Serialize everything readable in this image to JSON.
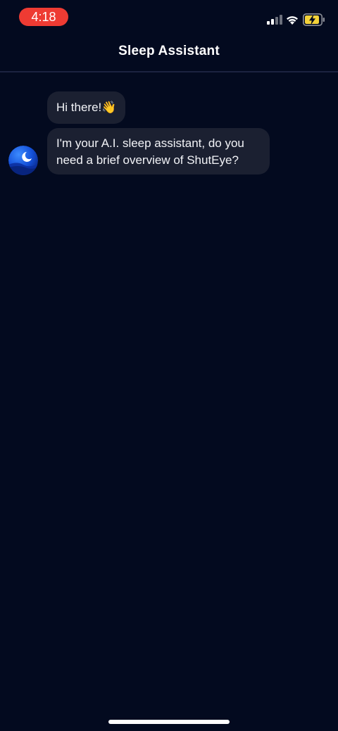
{
  "status_bar": {
    "time": "4:18",
    "icons": [
      "signal-icon",
      "wifi-icon",
      "battery-charging-icon"
    ],
    "time_pill_color": "#ee3b33"
  },
  "header": {
    "title": "Sleep Assistant"
  },
  "chat": {
    "messages": [
      {
        "sender": "assistant",
        "text": "Hi there!👋"
      },
      {
        "sender": "assistant",
        "text": "I'm your A.I. sleep assistant, do you need a brief overview of ShutEye?"
      }
    ],
    "avatar_icon": "moon-avatar-icon"
  },
  "theme": {
    "background": "#030a1f",
    "bubble": "#1b2031",
    "accent": "#2f7bff",
    "battery_fill": "#f4d23a"
  }
}
